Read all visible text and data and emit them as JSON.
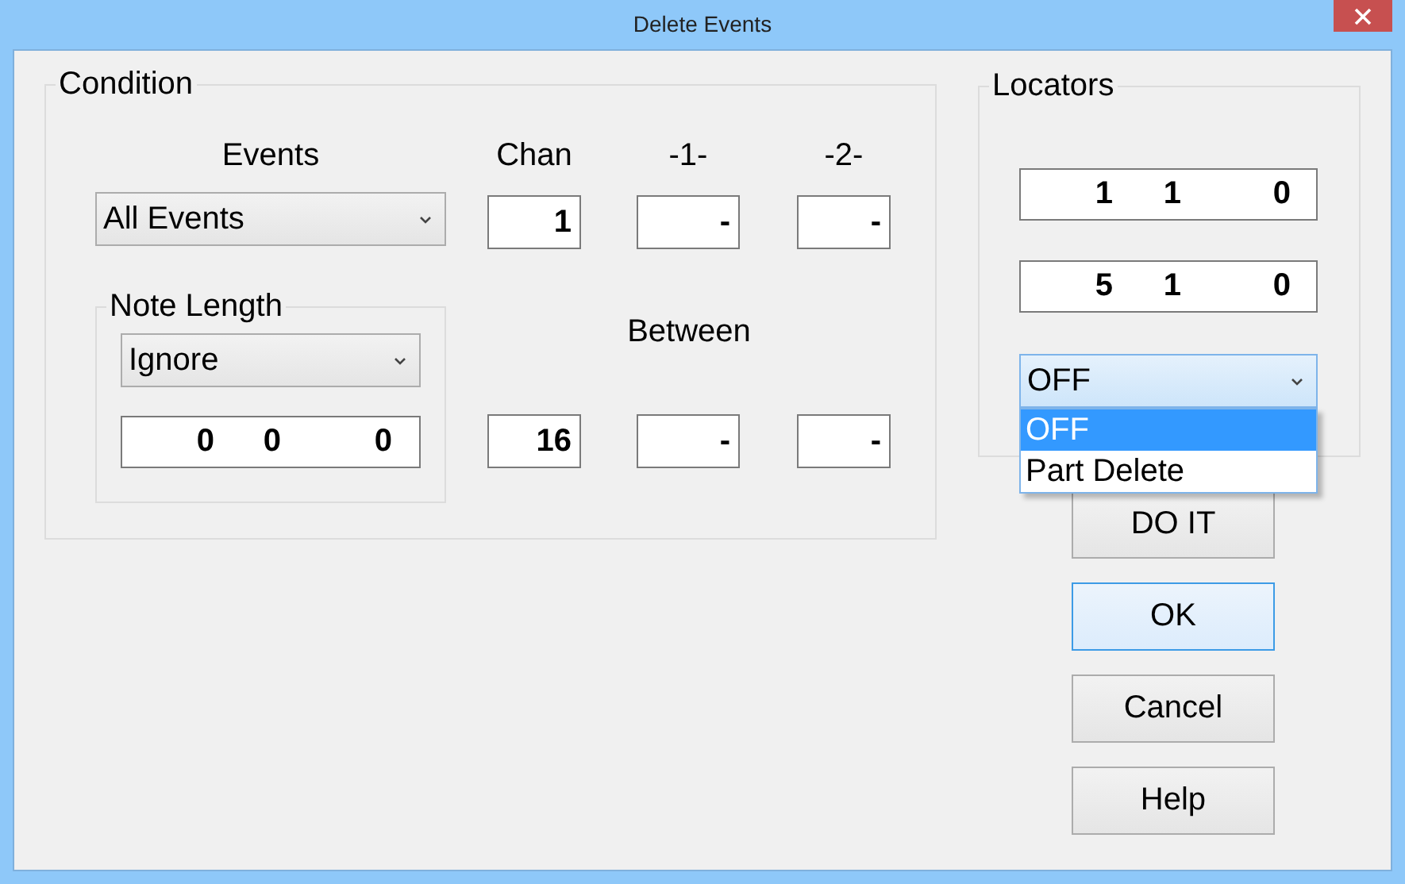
{
  "window": {
    "title": "Delete Events"
  },
  "condition": {
    "title": "Condition",
    "columns": [
      "Events",
      "Chan",
      "-1-",
      "-2-"
    ],
    "events_select": {
      "value": "All Events"
    },
    "channel_fields": [
      "1",
      "-",
      "-"
    ],
    "note_length": {
      "title": "Note Length",
      "select": {
        "value": "Ignore"
      },
      "field": [
        "0",
        "0",
        "0"
      ]
    },
    "between": {
      "label": "Between",
      "fields": [
        "16",
        "-",
        "-"
      ]
    }
  },
  "locators": {
    "title": "Locators",
    "fields": [
      [
        "1",
        "1",
        "0"
      ],
      [
        "5",
        "1",
        "0"
      ]
    ],
    "mode_select": {
      "value": "OFF",
      "expanded": true,
      "options": [
        {
          "label": "OFF",
          "selected": true
        },
        {
          "label": "Part Delete",
          "selected": false
        }
      ]
    }
  },
  "buttons": [
    {
      "label": "DO IT",
      "default": false
    },
    {
      "label": "OK",
      "default": true
    },
    {
      "label": "Cancel",
      "default": false
    },
    {
      "label": "Help",
      "default": false
    }
  ]
}
